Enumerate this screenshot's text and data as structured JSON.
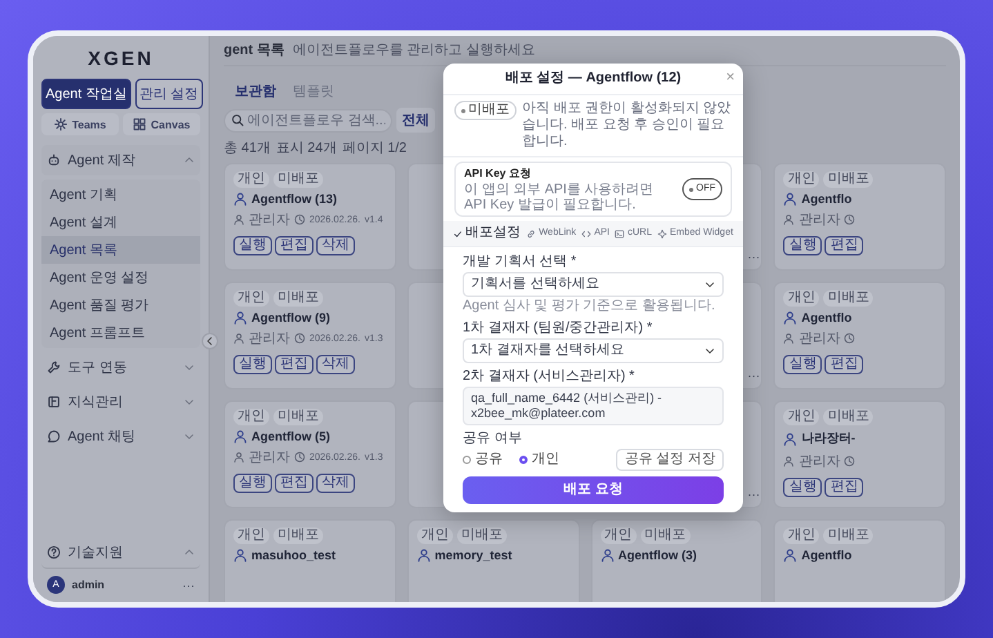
{
  "sidebar": {
    "logo": "XGEN",
    "mode_buttons": [
      {
        "label": "Agent 작업실",
        "selected": true
      },
      {
        "label": "관리 설정",
        "selected": false
      }
    ],
    "shortcuts": [
      {
        "label": "Teams"
      },
      {
        "label": "Canvas"
      }
    ],
    "groups": [
      {
        "label": "Agent 제작",
        "expanded": true,
        "children": [
          {
            "label": "Agent 기획",
            "selected": false
          },
          {
            "label": "Agent 설계",
            "selected": false
          },
          {
            "label": "Agent 목록",
            "selected": true
          },
          {
            "label": "Agent 운영 설정",
            "selected": false
          },
          {
            "label": "Agent 품질 평가",
            "selected": false
          },
          {
            "label": "Agent 프롬프트",
            "selected": false
          }
        ]
      },
      {
        "label": "도구 연동",
        "expanded": false
      },
      {
        "label": "지식관리",
        "expanded": false
      },
      {
        "label": "Agent 채팅",
        "expanded": false
      }
    ],
    "support": {
      "label": "기술지원",
      "expanded": true
    },
    "user": {
      "avatar": "A",
      "name": "admin",
      "more": "···"
    }
  },
  "header": {
    "title": "gent 목록",
    "subtitle": "에이전트플로우를 관리하고 실행하세요"
  },
  "tabs": [
    {
      "label": "보관함",
      "selected": true
    },
    {
      "label": "템플릿",
      "selected": false
    }
  ],
  "search": {
    "placeholder": "에이전트플로우 검색...",
    "filter": "전체"
  },
  "stats": [
    "총 41개",
    "표시 24개",
    "페이지 1/2"
  ],
  "cards": [
    {
      "kind": "full",
      "tags": [
        "개인",
        "미배포"
      ],
      "title": "Agentflow (13)",
      "author": "관리자",
      "date": "2026.02.26.",
      "version": "v1.4",
      "actions": [
        "실행",
        "편집",
        "삭제"
      ]
    },
    {
      "kind": "covered"
    },
    {
      "kind": "menu_only",
      "menu": "···"
    },
    {
      "kind": "full",
      "tags": [
        "개인",
        "미배포"
      ],
      "title": "Agentflo",
      "author": "관리자",
      "actions": [
        "실행",
        "편집"
      ]
    },
    {
      "kind": "full",
      "tags": [
        "개인",
        "미배포"
      ],
      "title": "Agentflow (9)",
      "author": "관리자",
      "date": "2026.02.26.",
      "version": "v1.3",
      "actions": [
        "실행",
        "편집",
        "삭제"
      ]
    },
    {
      "kind": "covered"
    },
    {
      "kind": "menu_only",
      "menu": "···"
    },
    {
      "kind": "full",
      "tags": [
        "개인",
        "미배포"
      ],
      "title": "Agentflo",
      "author": "관리자",
      "actions": [
        "실행",
        "편집"
      ]
    },
    {
      "kind": "full",
      "tags": [
        "개인",
        "미배포"
      ],
      "title": "Agentflow (5)",
      "author": "관리자",
      "date": "2026.02.26.",
      "version": "v1.3",
      "actions": [
        "실행",
        "편집",
        "삭제"
      ]
    },
    {
      "kind": "covered"
    },
    {
      "kind": "menu_only",
      "menu": "···"
    },
    {
      "kind": "full",
      "tags": [
        "개인",
        "미배포"
      ],
      "title": "나라장터-",
      "author": "관리자",
      "actions": [
        "실행",
        "편집"
      ]
    },
    {
      "kind": "full",
      "tags": [
        "개인",
        "미배포"
      ],
      "title": "masuhoo_test"
    },
    {
      "kind": "full",
      "tags": [
        "개인",
        "미배포"
      ],
      "title": "memory_test"
    },
    {
      "kind": "full",
      "tags": [
        "개인",
        "미배포"
      ],
      "title": "Agentflow (3)"
    },
    {
      "kind": "full",
      "tags": [
        "개인",
        "미배포"
      ],
      "title": "Agentflo"
    }
  ],
  "modal": {
    "title": "배포 설정 — Agentflow (12)",
    "close": "×",
    "status": "미배포",
    "notice": "아직 배포 권한이 활성화되지 않았습니다. 배포 요청 후 승인이 필요합니다.",
    "api_key": {
      "title": "API Key 요청",
      "description": "이 앱의 외부 API를 사용하려면 API Key 발급이 필요합니다.",
      "toggle": {
        "label": "OFF",
        "on": false
      }
    },
    "tabs": [
      {
        "label": "배포설정",
        "selected": true
      },
      {
        "label": "WebLink",
        "selected": false
      },
      {
        "label": "API",
        "selected": false
      },
      {
        "label": "cURL",
        "selected": false
      },
      {
        "label": "Embed Widget",
        "selected": false
      }
    ],
    "fields": [
      {
        "kind": "select",
        "label": "개발 기획서 선택 *",
        "value": "기획서를 선택하세요",
        "hint": "Agent 심사 및 평가 기준으로 활용됩니다."
      },
      {
        "kind": "select",
        "label": "1차 결재자 (팀원/중간관리자) *",
        "value": "1차 결재자를 선택하세요"
      },
      {
        "kind": "text",
        "label": "2차 결재자 (서비스관리자) *",
        "value": "qa_full_name_6442 (서비스관리) - x2bee_mk@plateer.com"
      }
    ],
    "share": {
      "label": "공유 여부",
      "options": [
        {
          "label": "공유",
          "selected": false
        },
        {
          "label": "개인",
          "selected": true
        }
      ],
      "save": "공유 설정 저장"
    },
    "submit": "배포 요청"
  }
}
